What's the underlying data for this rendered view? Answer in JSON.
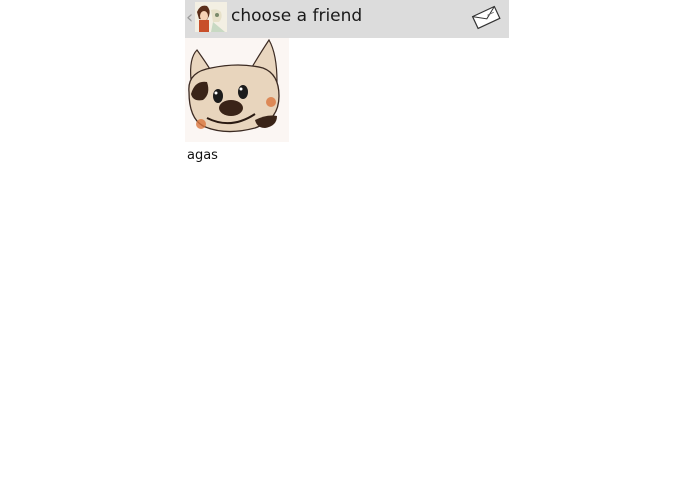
{
  "header": {
    "title": "choose a friend",
    "back_icon": "chevron-left-icon",
    "app_icon": "app-avatar-icon",
    "compose_icon": "envelope-icon"
  },
  "friends": [
    {
      "name": "agas",
      "avatar_icon": "cartoon-dog-avatar"
    }
  ],
  "colors": {
    "action_bar": "#dcdcdc",
    "background": "#ffffff"
  }
}
